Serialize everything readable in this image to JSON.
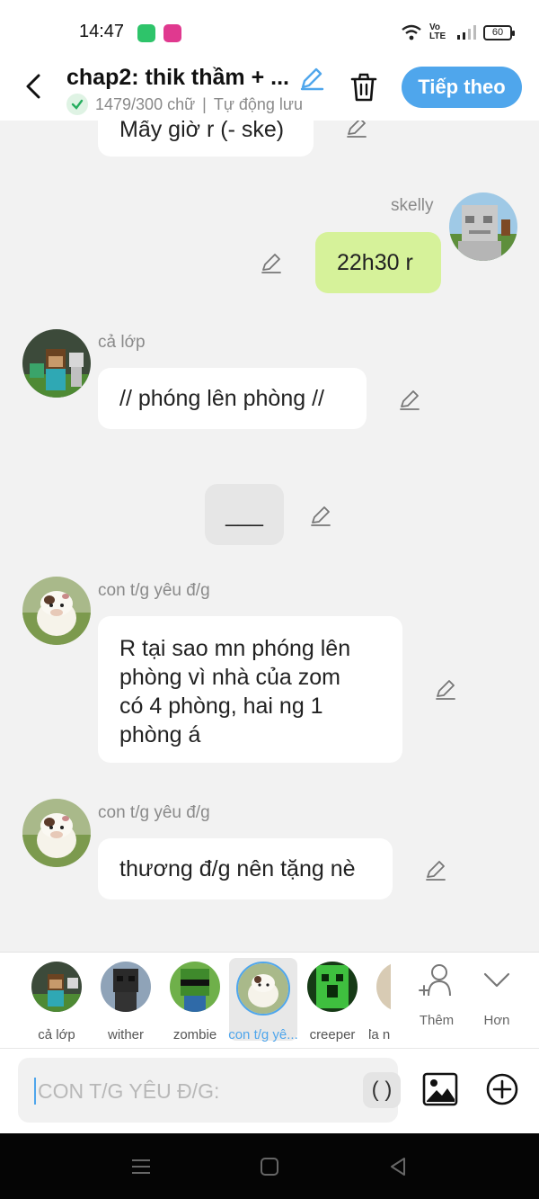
{
  "status_bar": {
    "time": "14:47",
    "network": "Vo LTE",
    "battery": "60"
  },
  "header": {
    "title": "chap2: thik thầm + ...",
    "word_count": "1479/300 chữ",
    "autosave": "Tự động lưu",
    "next_label": "Tiếp theo"
  },
  "messages": [
    {
      "speaker": "",
      "text": "Mấy giờ r (- ske)",
      "side": "left"
    },
    {
      "speaker": "skelly",
      "text": "22h30 r",
      "side": "right"
    },
    {
      "speaker": "cả lớp",
      "text": "// phóng lên phòng //",
      "side": "left"
    },
    {
      "speaker": "",
      "text": "___",
      "side": "center"
    },
    {
      "speaker": "con t/g yêu đ/g",
      "text": [
        "R tại sao mn phóng lên",
        "phòng vì nhà của zom",
        "có 4 phòng, hai ng 1",
        "phòng á"
      ],
      "side": "left"
    },
    {
      "speaker": "con t/g yêu đ/g",
      "text": "thương đ/g nên tặng nè",
      "side": "left"
    }
  ],
  "characters": [
    {
      "label": "cả lớp"
    },
    {
      "label": "wither"
    },
    {
      "label": "zombie"
    },
    {
      "label": "con t/g yê...",
      "selected": true
    },
    {
      "label": "creeper"
    },
    {
      "label": "đa n"
    }
  ],
  "char_actions": {
    "add_label": "Thêm",
    "more_label": "Hơn"
  },
  "input": {
    "placeholder": "CON T/G YÊU Đ/G:",
    "paren_label": "( )"
  },
  "colors": {
    "accent": "#4fa6ec",
    "my_bubble": "#d6f29a",
    "chat_bg": "#f2f2f2"
  }
}
